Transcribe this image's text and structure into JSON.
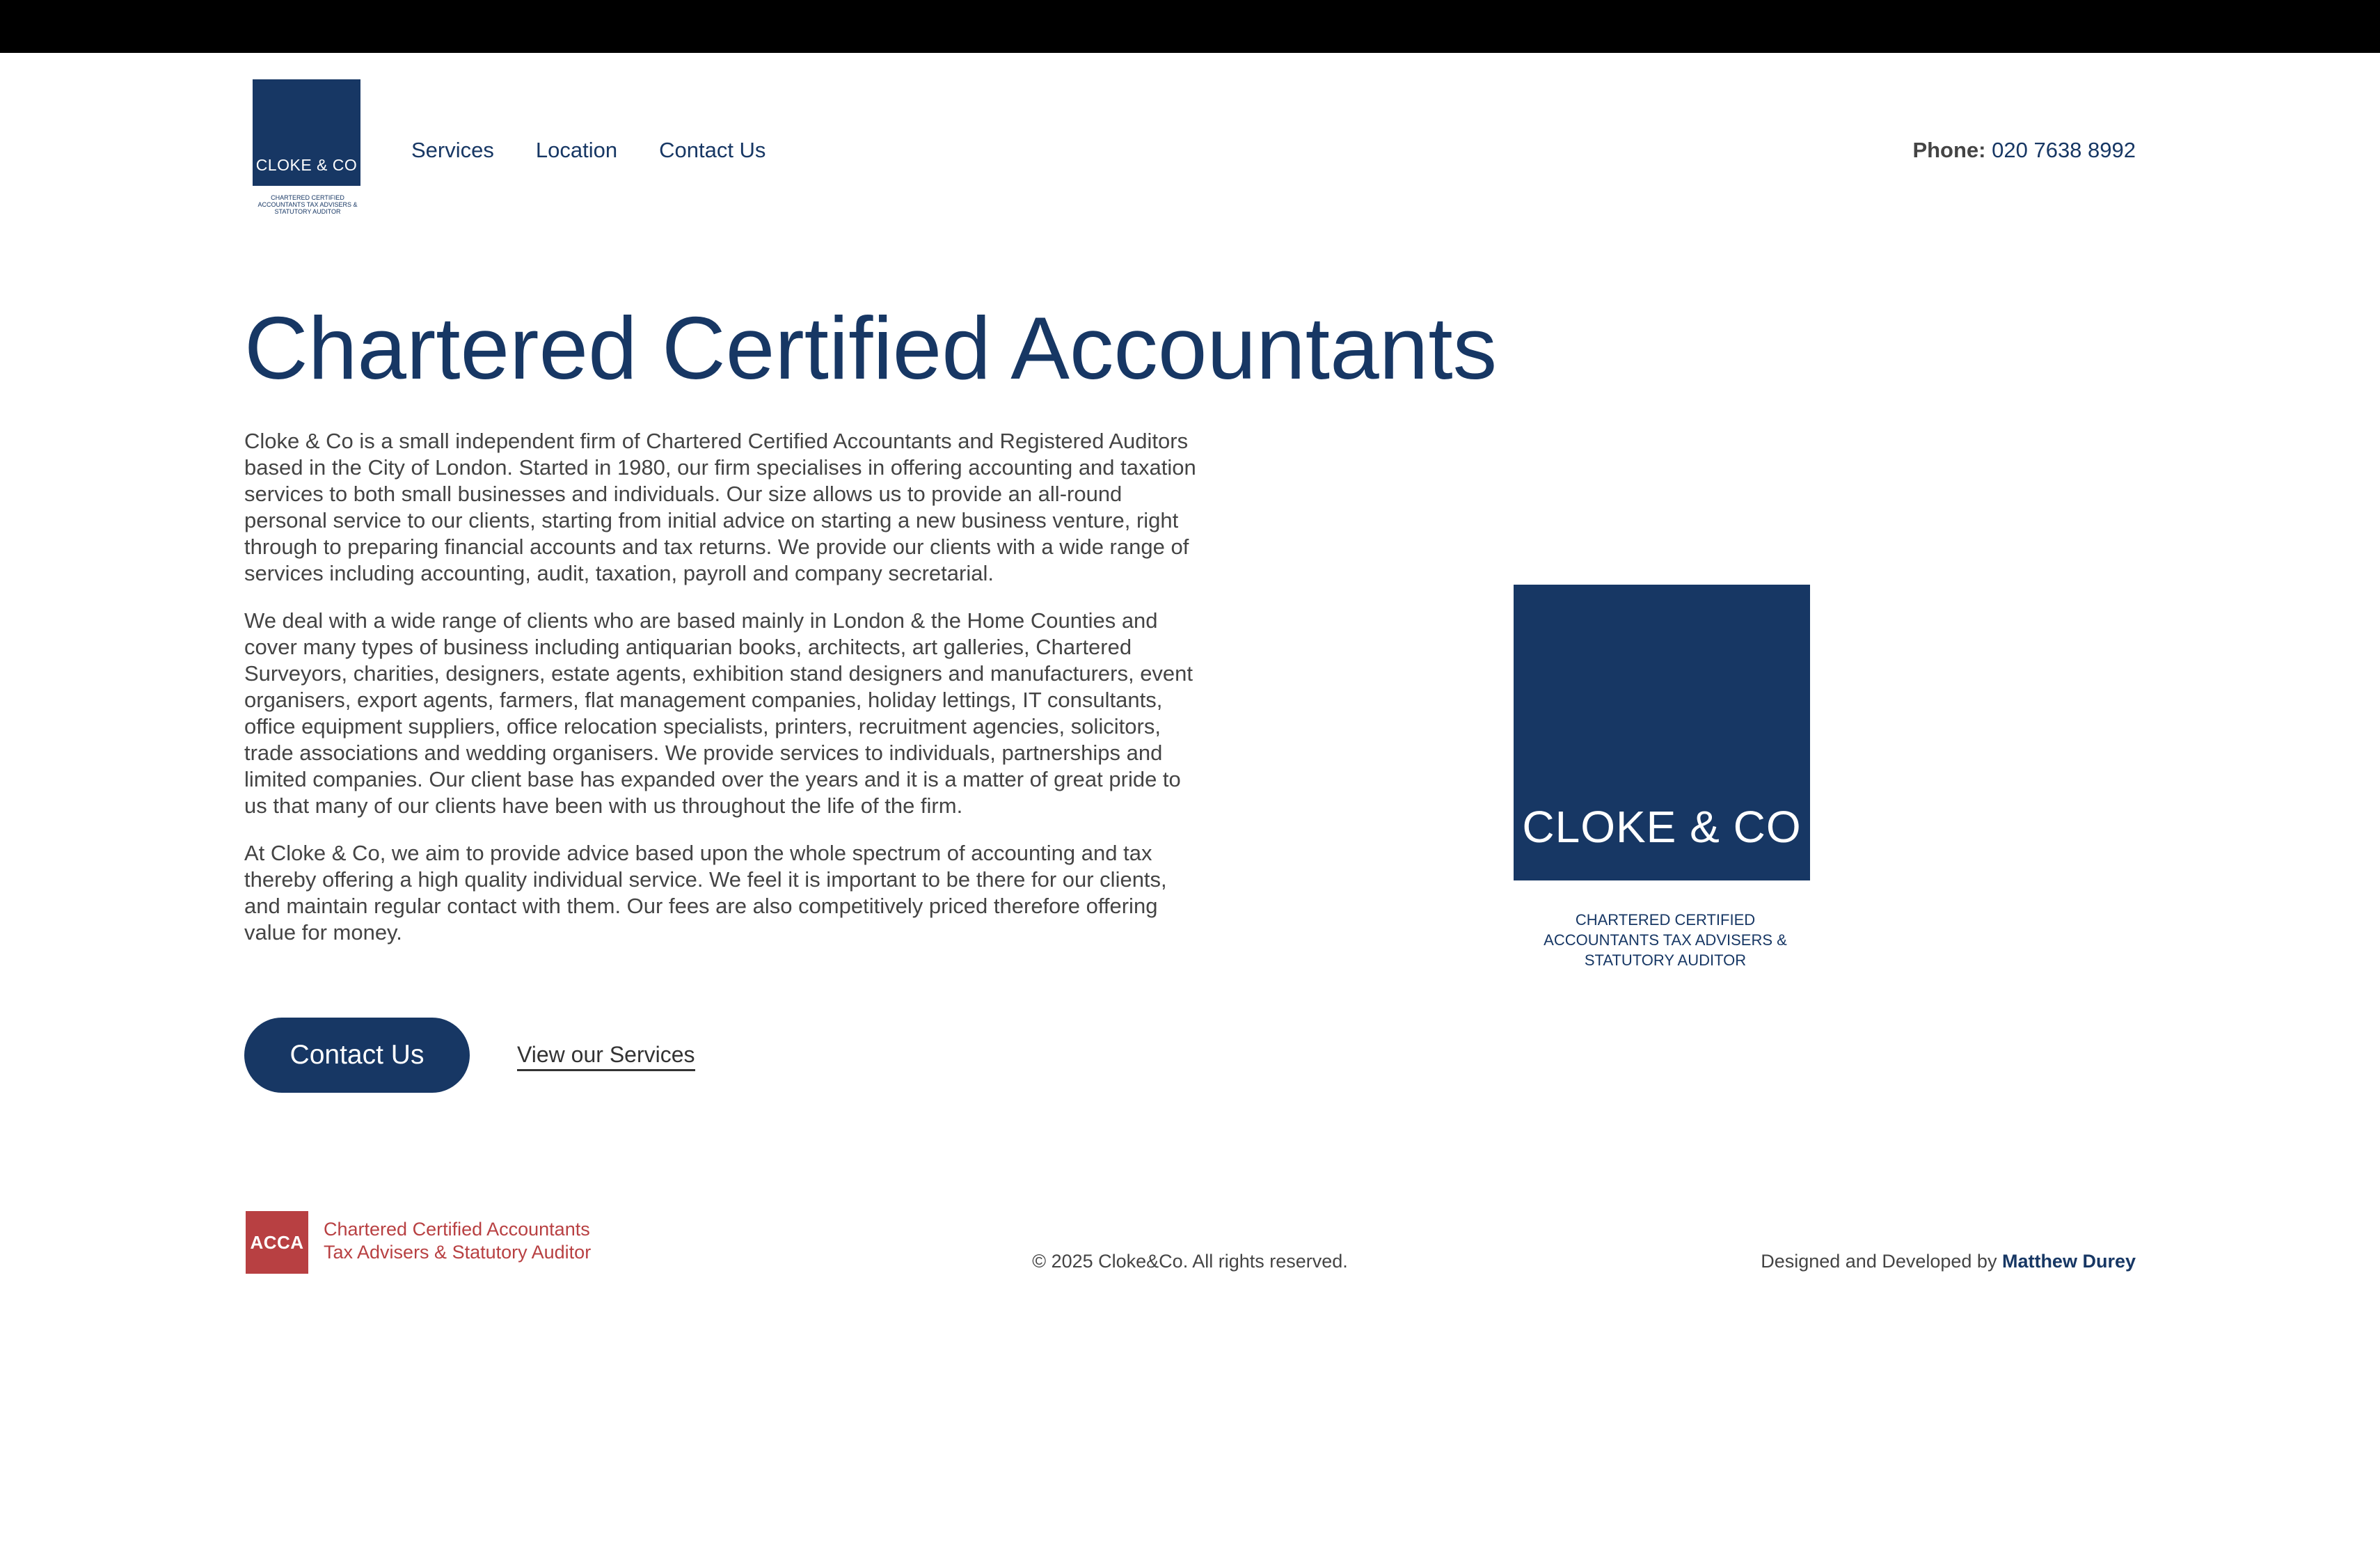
{
  "header": {
    "logo": {
      "text": "CLOKE & CO",
      "caption": "CHARTERED CERTIFIED ACCOUNTANTS TAX ADVISERS & STATUTORY AUDITOR"
    },
    "nav": [
      {
        "label": "Services"
      },
      {
        "label": "Location"
      },
      {
        "label": "Contact Us"
      }
    ],
    "phone_label": "Phone:",
    "phone_number": "020 7638 8992"
  },
  "hero": {
    "title": "Chartered Certified Accountants",
    "paragraphs": [
      "Cloke & Co is a small independent firm of Chartered Certified Accountants and Registered Auditors based in the City of London. Started in 1980, our firm specialises in offering accounting and taxation services to both small businesses and individuals. Our size allows us to provide an all-round personal service to our clients, starting from initial advice on starting a new business venture, right through to preparing financial accounts and tax returns. We provide our clients with a wide range of services including accounting, audit, taxation, payroll and company secretarial.",
      "We deal with a wide range of clients who are based mainly in London & the Home Counties and cover many types of business including antiquarian books, architects, art galleries, Chartered Surveyors, charities, designers, estate agents, exhibition stand designers and manufacturers, event organisers, export agents, farmers, flat management companies, holiday lettings, IT consultants, office equipment suppliers, office relocation specialists, printers, recruitment agencies, solicitors, trade associations and wedding organisers. We provide services to individuals, partnerships and limited companies. Our client base has expanded over the years and it is a matter of great pride to us that many of our clients have been with us throughout the life of the firm.",
      "At Cloke & Co, we aim to provide advice based upon the whole spectrum of accounting and tax thereby offering a high quality individual service. We feel it is important to be there for our clients, and maintain regular contact with them. Our fees are also competitively priced therefore offering value for money."
    ],
    "contact_button": "Contact Us",
    "services_link": "View our Services"
  },
  "feature_logo": {
    "text": "CLOKE & CO",
    "caption_lines": [
      "CHARTERED CERTIFIED",
      "ACCOUNTANTS TAX ADVISERS &",
      "STATUTORY AUDITOR"
    ]
  },
  "footer": {
    "acca_badge": "ACCA",
    "acca_line1": "Chartered Certified Accountants",
    "acca_line2": "Tax Advisers & Statutory Auditor",
    "copyright": "© 2025 Cloke&Co. All rights reserved.",
    "credits_prefix": "Designed and Developed by ",
    "credits_name": "Matthew Durey"
  },
  "colors": {
    "brand_navy": "#173764",
    "acca_red": "#b84042",
    "topbar": "#000000",
    "body_text": "#444444"
  }
}
